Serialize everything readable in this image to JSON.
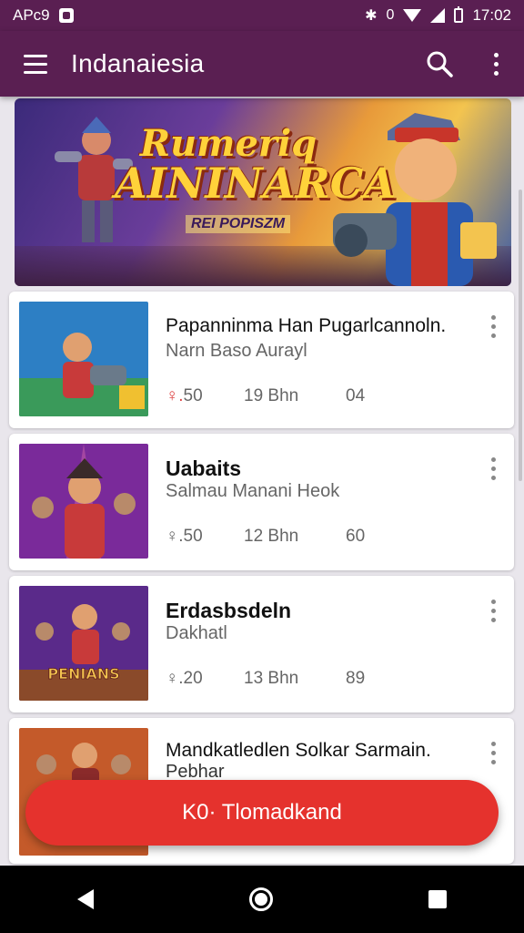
{
  "status_bar": {
    "left_text": "APc9",
    "time": "17:02"
  },
  "app_bar": {
    "title": "Indanaiesia"
  },
  "banner": {
    "title_line1": "Rumeriq",
    "title_line2": "AININARCA",
    "subtitle": "REI POPISZM"
  },
  "items": [
    {
      "title": "Papanninma Han Pugarlcannoln.",
      "subtitle": "Narn Baso Aurayl",
      "rating": "♀.50",
      "size": "19 Bhn",
      "count": "04",
      "title_bold": false
    },
    {
      "title": "Uabaits",
      "subtitle": "Salmau Manani Heok",
      "rating": "♀.50",
      "size": "12 Bhn",
      "count": "60",
      "title_bold": true
    },
    {
      "title": "Erdasbsdeln",
      "subtitle": "Dakhatl",
      "rating": "♀.20",
      "size": "13 Bhn",
      "count": "89",
      "title_bold": true
    },
    {
      "title": "Mandkatledlen Solkar Sarmain.",
      "subtitle": "Pebhar",
      "title_bold": false
    }
  ],
  "thumbs": [
    {
      "bg": "#2d7fc4",
      "label": ""
    },
    {
      "bg": "#7a2a9a",
      "label": ""
    },
    {
      "bg": "#5a2a8a",
      "label": "PENIANS"
    },
    {
      "bg": "#c45a2a",
      "label": ""
    }
  ],
  "fab": {
    "label": "K0· Tlomadkand"
  },
  "colors": {
    "primary": "#5a1f52",
    "accent": "#e5322d"
  }
}
